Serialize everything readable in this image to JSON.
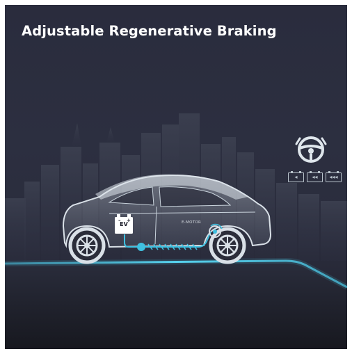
{
  "title": "Adjustable Regenerative Braking",
  "car_labels": {
    "battery": "EV",
    "motor": "E-MOTOR"
  },
  "regen_levels": [
    "◂",
    "◂◂",
    "◂◂◂"
  ],
  "icons": {
    "steering_wheel": "steering-wheel-paddle-icon",
    "battery": "battery-icon",
    "motor": "e-motor-icon"
  },
  "colors": {
    "background": "#2b2d3e",
    "road_glow": "#4cc8e6",
    "energy_flow": "#3fc0e0",
    "battery_fill": "#ffffff",
    "car_body": "#c9d3dc"
  }
}
